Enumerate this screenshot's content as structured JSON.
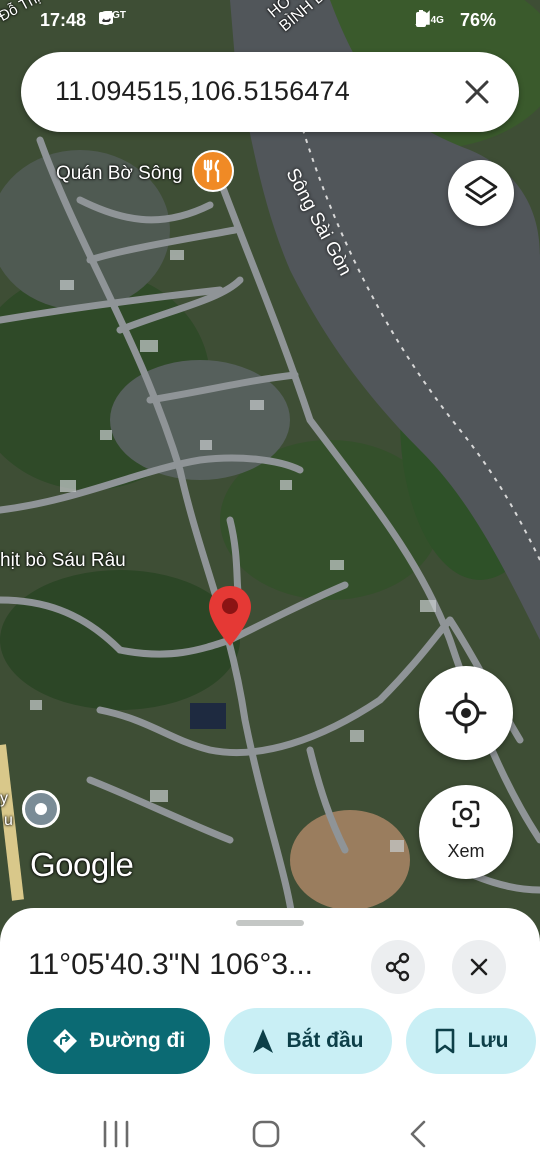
{
  "status_bar": {
    "time": "17:48",
    "left_icons": [
      "image-icon",
      "news-icon",
      "shield-icon"
    ],
    "news_text": "TGT",
    "right_icons": [
      "location-icon",
      "signal-icon",
      "4g-icon",
      "signal-icon"
    ],
    "network": "4G",
    "battery": "76%"
  },
  "search": {
    "query": "11.094515,106.5156474",
    "clear_icon": "close-icon"
  },
  "map": {
    "labels": {
      "top_left": "Đỗ Thị Ch",
      "top_right": "HỒ CHÍ BÌNH DU",
      "restaurant": "Quán Bờ Sông",
      "river": "Sông Sài Gòn",
      "beef_shop": "hịt bò Sáu Râu",
      "partial_left_1": "y",
      "partial_left_2": "u"
    },
    "watermark": "Google",
    "colors": {
      "river": "#51565a",
      "road": "#8f9497",
      "pin": "#e53935",
      "poi": "#f08a25"
    }
  },
  "controls": {
    "layers_icon": "layers-icon",
    "my_location_icon": "my-location-icon",
    "lens_icon": "camera-lens-icon",
    "lens_label": "Xem"
  },
  "sheet": {
    "coordinates": "11°05'40.3\"N 106°3...",
    "share_icon": "share-icon",
    "close_icon": "close-icon",
    "directions_label": "Đường đi",
    "start_label": "Bắt đầu",
    "save_label": "Lưu",
    "colors": {
      "primary": "#0b6a73",
      "tonal": "#c9eff5"
    }
  },
  "nav": {
    "icons": [
      "recent-apps-icon",
      "home-icon",
      "back-icon"
    ]
  }
}
